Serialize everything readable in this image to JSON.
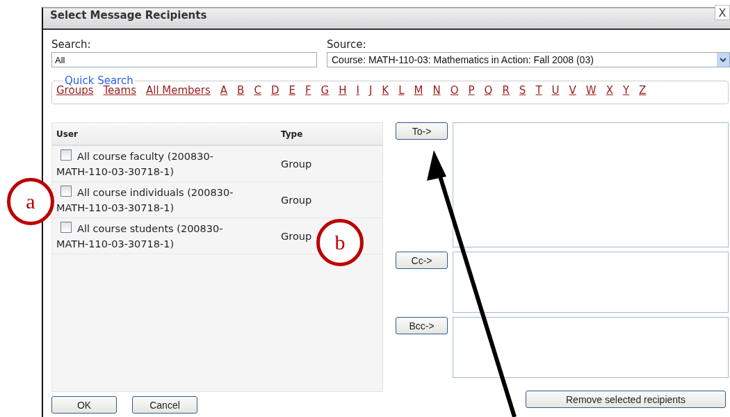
{
  "dialog": {
    "title": "Select Message Recipients",
    "close": "X"
  },
  "search": {
    "label": "Search:",
    "value": "All"
  },
  "source": {
    "label": "Source:",
    "value": "Course: MATH-110-03: Mathematics in Action: Fall 2008 (03)"
  },
  "quick_search": {
    "legend": "Quick Search",
    "links": [
      "Groups",
      "Teams",
      "All Members",
      "A",
      "B",
      "C",
      "D",
      "E",
      "F",
      "G",
      "H",
      "I",
      "J",
      "K",
      "L",
      "M",
      "N",
      "O",
      "P",
      "Q",
      "R",
      "S",
      "T",
      "U",
      "V",
      "W",
      "X",
      "Y",
      "Z"
    ]
  },
  "table": {
    "columns": [
      "User",
      "Type"
    ],
    "rows": [
      {
        "user": "All course faculty (200830-MATH-110-03-30718-1)",
        "type": "Group",
        "checked": false
      },
      {
        "user": "All course individuals (200830-MATH-110-03-30718-1)",
        "type": "Group",
        "checked": false
      },
      {
        "user": "All course students (200830-MATH-110-03-30718-1)",
        "type": "Group",
        "checked": false
      }
    ]
  },
  "recipient_buttons": [
    "To->",
    "Cc->",
    "Bcc->"
  ],
  "remove_button": "Remove selected recipients",
  "buttons": [
    "OK",
    "Cancel"
  ],
  "annotations": [
    {
      "label": "a"
    },
    {
      "label": "b"
    }
  ]
}
